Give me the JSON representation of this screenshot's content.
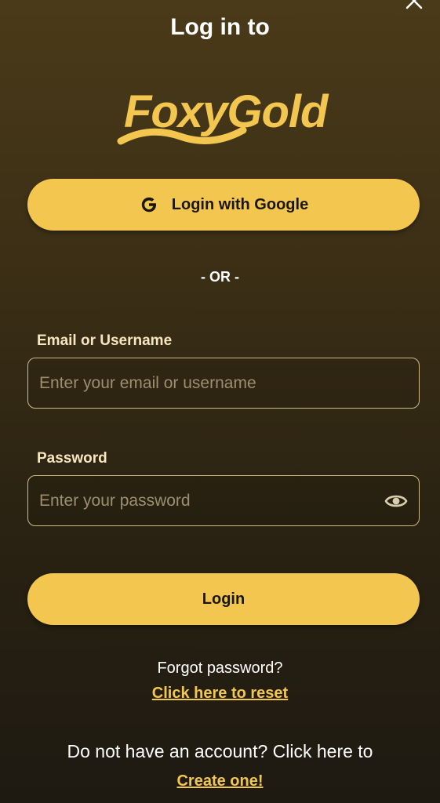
{
  "header": {
    "title": "Log in to",
    "logo_text": "FoxyGold"
  },
  "google_button": {
    "label": "Login with Google",
    "icon": "google-g-icon"
  },
  "divider": {
    "text": "- OR -"
  },
  "email": {
    "label": "Email or Username",
    "placeholder": "Enter your email or username",
    "value": ""
  },
  "password": {
    "label": "Password",
    "placeholder": "Enter your password",
    "value": "",
    "toggle_icon": "eye-icon"
  },
  "login_button": {
    "label": "Login"
  },
  "forgot": {
    "text": "Forgot password?",
    "link": "Click here to reset"
  },
  "signup": {
    "text": "Do not have an account? Click here to",
    "link": "Create one!"
  },
  "colors": {
    "accent": "#f3c74f",
    "label": "#f7e7c0",
    "background_top": "#4a3a19",
    "background_bottom": "#1e1a12"
  }
}
